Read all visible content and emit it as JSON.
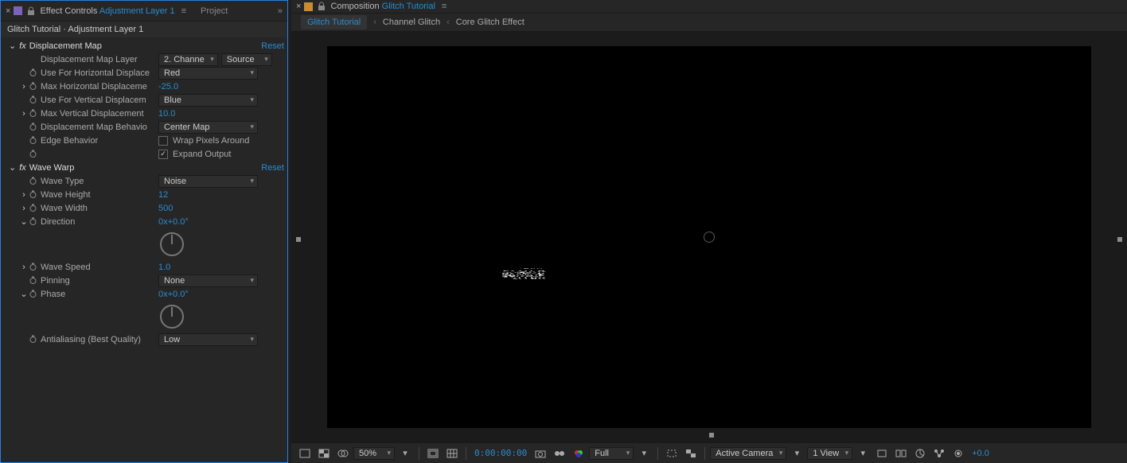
{
  "left_panel": {
    "tab_prefix": "Effect Controls",
    "tab_layer": "Adjustment Layer 1",
    "secondary_tab": "Project",
    "context": "Glitch Tutorial · Adjustment Layer 1"
  },
  "effects": {
    "displacement_map": {
      "name": "Displacement Map",
      "reset": "Reset",
      "layer_label": "Displacement Map Layer",
      "layer_value": "2. Channe",
      "layer_source": "Source",
      "h_use_label": "Use For Horizontal Displace",
      "h_use_value": "Red",
      "h_max_label": "Max Horizontal Displaceme",
      "h_max_value": "-25.0",
      "v_use_label": "Use For Vertical Displacem",
      "v_use_value": "Blue",
      "v_max_label": "Max Vertical Displacement",
      "v_max_value": "10.0",
      "behavior_label": "Displacement Map Behavio",
      "behavior_value": "Center Map",
      "edge_label": "Edge Behavior",
      "wrap_label": "Wrap Pixels Around",
      "expand_label": "Expand Output"
    },
    "wave_warp": {
      "name": "Wave Warp",
      "reset": "Reset",
      "type_label": "Wave Type",
      "type_value": "Noise",
      "height_label": "Wave Height",
      "height_value": "12",
      "width_label": "Wave Width",
      "width_value": "500",
      "direction_label": "Direction",
      "direction_value": "0x+0.0°",
      "speed_label": "Wave Speed",
      "speed_value": "1.0",
      "pinning_label": "Pinning",
      "pinning_value": "None",
      "phase_label": "Phase",
      "phase_value": "0x+0.0°",
      "aa_label": "Antialiasing (Best Quality)",
      "aa_value": "Low"
    }
  },
  "comp_panel": {
    "tab_prefix": "Composition",
    "tab_name": "Glitch Tutorial",
    "crumbs": [
      "Glitch Tutorial",
      "Channel Glitch",
      "Core Glitch Effect"
    ],
    "content_text": "GLITCH"
  },
  "footer": {
    "zoom": "50%",
    "timecode": "0:00:00:00",
    "resolution": "Full",
    "camera": "Active Camera",
    "views": "1 View",
    "exposure": "+0.0"
  }
}
